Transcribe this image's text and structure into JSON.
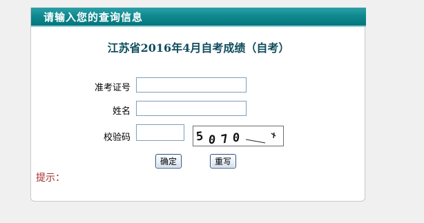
{
  "header": {
    "title": "请输入您的查询信息"
  },
  "form": {
    "title": "江苏省2016年4月自考成绩（自考）",
    "admission_label": "准考证号",
    "admission_value": "",
    "name_label": "姓名",
    "name_value": "",
    "captcha_label": "校验码",
    "captcha_value": "",
    "captcha_text": "5070",
    "submit_label": "确定",
    "reset_label": "重写"
  },
  "hint": {
    "label": "提示："
  }
}
